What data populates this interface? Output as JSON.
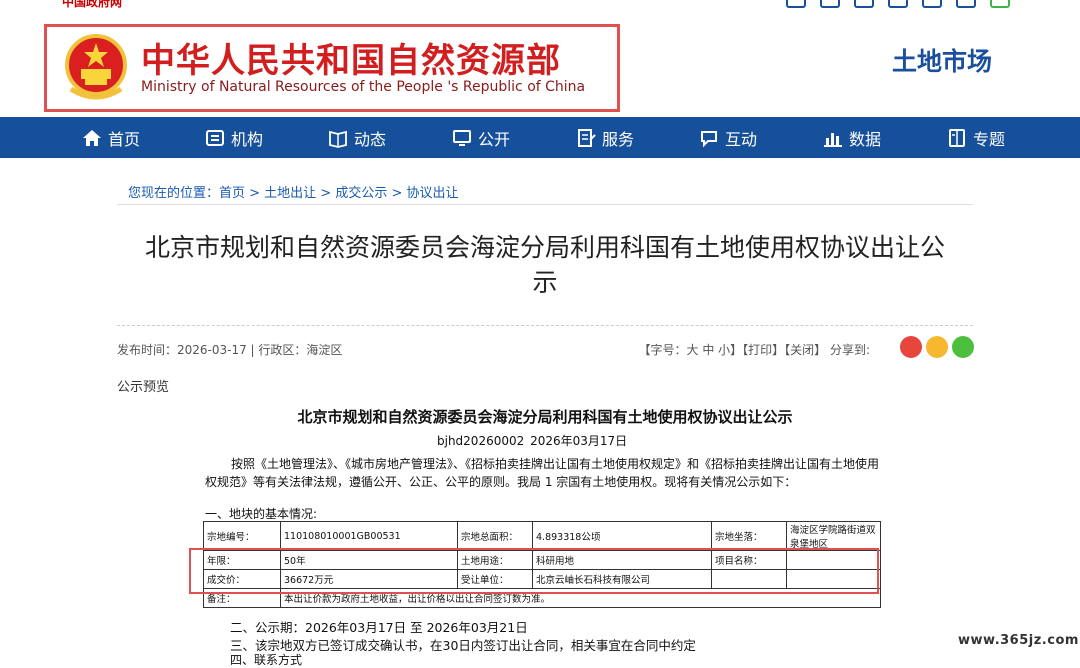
{
  "topbar": {
    "gov_link": "中国政府网"
  },
  "header": {
    "ministry_cn": "中华人民共和国自然资源部",
    "ministry_en": "Ministry of Natural Resources of the People 's Republic of China",
    "site_name": "土地市场"
  },
  "nav": [
    {
      "label": "首页",
      "icon": "home-icon"
    },
    {
      "label": "机构",
      "icon": "org-icon"
    },
    {
      "label": "动态",
      "icon": "book-icon"
    },
    {
      "label": "公开",
      "icon": "monitor-icon"
    },
    {
      "label": "服务",
      "icon": "doc-edit-icon"
    },
    {
      "label": "互动",
      "icon": "chat-icon"
    },
    {
      "label": "数据",
      "icon": "bar-chart-icon"
    },
    {
      "label": "专题",
      "icon": "book-open-icon"
    }
  ],
  "breadcrumb": "您现在的位置：首页 > 土地出让 > 成交公示 > 协议出让",
  "title_line1": "北京市规划和自然资源委员会海淀分局利用科国有土地使用权协议出让公",
  "title_line2": "示",
  "meta": "发布时间：2026-03-17  |  行政区：海淀区",
  "tools": "【字号：大 中 小】【打印】【关闭】 分享到:",
  "preview_label": "公示预览",
  "doc": {
    "title": "北京市规划和自然资源委员会海淀分局利用科国有土地使用权协议出让公示",
    "id_line": "bjhd20260002      2026年03月17日",
    "para": "按照《土地管理法》、《城市房地产管理法》、《招标拍卖挂牌出让国有土地使用权规定》和《招标拍卖挂牌出让国有土地使用权规范》等有关法律法规，遵循公开、公正、公平的原则。我局 1 宗国有土地使用权。现将有关情况公示如下：",
    "sec1": "一、地块的基本情况:",
    "table": {
      "r1": [
        "宗地编号：",
        "110108010001GB00531",
        "宗地总面积：",
        "4.893318公顷",
        "宗地坐落：",
        "海淀区学院路街道双泉堡地区"
      ],
      "r2": [
        "年限：",
        "50年",
        "土地用途：",
        "科研用地",
        "项目名称：",
        ""
      ],
      "r3": [
        "成交价：",
        "36672万元",
        "受让单位：",
        "北京云岫长石科技有限公司",
        "",
        ""
      ],
      "r4": [
        "备注：",
        "本出让价款为政府土地收益，出让价格以出让合同签订数为准。"
      ]
    },
    "sec2": "二、公示期：2026年03月17日 至 2026年03月21日",
    "sec3": "三、该宗地双方已签订成交确认书，在30日内签订出让合同，相关事宜在合同中约定",
    "sec4": "四、联系方式"
  },
  "watermark": "www.365jz.com",
  "colors": {
    "nav_bg": "#17509a",
    "brand_red": "#d21e1e",
    "link_blue": "#1a5ab0",
    "highlight_red": "#e05050"
  }
}
